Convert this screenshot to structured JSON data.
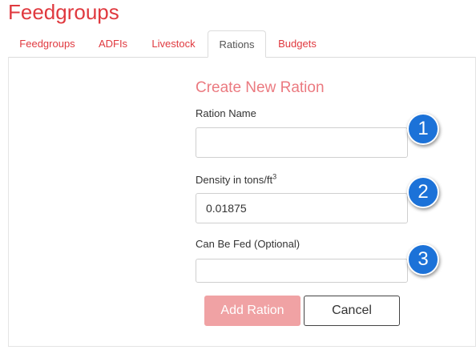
{
  "page": {
    "title": "Feedgroups"
  },
  "tabs": [
    {
      "label": "Feedgroups",
      "active": false
    },
    {
      "label": "ADFIs",
      "active": false
    },
    {
      "label": "Livestock",
      "active": false
    },
    {
      "label": "Rations",
      "active": true
    },
    {
      "label": "Budgets",
      "active": false
    }
  ],
  "form": {
    "title": "Create New Ration",
    "ration_name": {
      "label": "Ration Name",
      "value": ""
    },
    "density": {
      "label": "Density in tons/ft",
      "unit_exponent": "3",
      "value": "0.01875"
    },
    "can_be_fed": {
      "label": "Can Be Fed (Optional)",
      "value": ""
    },
    "add_button": "Add Ration",
    "cancel_button": "Cancel"
  },
  "markers": [
    "1",
    "2",
    "3"
  ],
  "colors": {
    "accent": "#e0393f",
    "marker": "#1c72d8",
    "add_button": "#f0a2a4"
  }
}
